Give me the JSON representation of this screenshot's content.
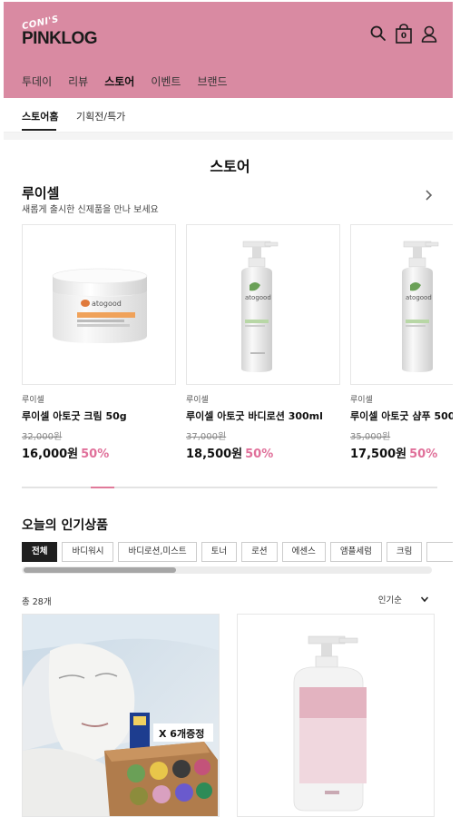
{
  "header": {
    "logo_small": "CONI'S",
    "logo_main": "PINKLOG",
    "cart_count": "0",
    "icons": [
      "search-icon",
      "shopping-bag-icon",
      "user-icon"
    ],
    "bg_color": "#d98aa2"
  },
  "nav": {
    "items": [
      "투데이",
      "리뷰",
      "스토어",
      "이벤트",
      "브랜드"
    ],
    "active": "스토어"
  },
  "subnav": {
    "items": [
      "스토어홈",
      "기획전/특가"
    ]
  },
  "page_title": "스토어",
  "brand_section": {
    "title": "루이셀",
    "subtitle": "새롭게 출시한 신제품을 만나 보세요",
    "products": [
      {
        "brand": "루이셀",
        "name": "루이셀 아토굿 크림 50g",
        "old_price": "32,000원",
        "price": "16,000원",
        "discount": "50%",
        "image": "cream-jar"
      },
      {
        "brand": "루이셀",
        "name": "루이셀 아토굿 바디로션 300ml",
        "old_price": "37,000원",
        "price": "18,500원",
        "discount": "50%",
        "image": "pump-bottle"
      },
      {
        "brand": "루이셀",
        "name": "루이셀 아토굿 샴푸 500",
        "old_price": "35,000원",
        "price": "17,500원",
        "discount": "50%",
        "image": "pump-bottle"
      }
    ],
    "product_label": "atogood",
    "accent_color": "#e0709a"
  },
  "popular_section": {
    "title": "오늘의 인기상품",
    "chips": [
      "전체",
      "바디워시",
      "바디로션,미스트",
      "토너",
      "로션",
      "에센스",
      "앰플세럼",
      "크림"
    ],
    "active_chip": "전체",
    "total": "총 28개",
    "sort": "인기순",
    "promo_text": "X 6개증정"
  }
}
